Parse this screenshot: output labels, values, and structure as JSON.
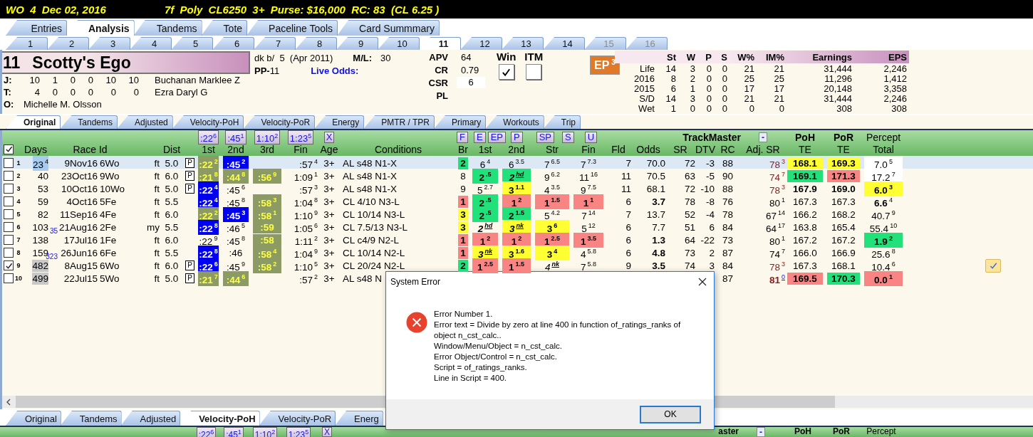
{
  "title_bar": {
    "race": "WO  4  Dec 02, 2016",
    "conditions": "7f  Poly  CL6250  3+  Purse: $16,000  RC: 83  (CL 6.25 )"
  },
  "main_tabs": [
    {
      "label": "Entries",
      "selected": false
    },
    {
      "label": "Analysis",
      "selected": true
    },
    {
      "label": "Tandems",
      "selected": false
    },
    {
      "label": "Tote",
      "selected": false
    },
    {
      "label": "Paceline Tools",
      "selected": false
    },
    {
      "label": "Card Summmary",
      "selected": false
    }
  ],
  "horse_tabs": [
    {
      "label": "1",
      "selected": false,
      "disabled": false
    },
    {
      "label": "2",
      "selected": false,
      "disabled": false
    },
    {
      "label": "3",
      "selected": false,
      "disabled": false
    },
    {
      "label": "4",
      "selected": false,
      "disabled": false
    },
    {
      "label": "5",
      "selected": false,
      "disabled": false
    },
    {
      "label": "6",
      "selected": false,
      "disabled": false
    },
    {
      "label": "7",
      "selected": false,
      "disabled": false
    },
    {
      "label": "8",
      "selected": false,
      "disabled": false
    },
    {
      "label": "9",
      "selected": false,
      "disabled": false
    },
    {
      "label": "10",
      "selected": false,
      "disabled": false
    },
    {
      "label": "11",
      "selected": true,
      "disabled": false
    },
    {
      "label": "12",
      "selected": false,
      "disabled": false
    },
    {
      "label": "13",
      "selected": false,
      "disabled": false
    },
    {
      "label": "14",
      "selected": false,
      "disabled": false
    },
    {
      "label": "15",
      "selected": false,
      "disabled": true
    },
    {
      "label": "16",
      "selected": false,
      "disabled": true
    }
  ],
  "horse": {
    "number": "11",
    "name": "Scotty's Ego",
    "description": "dk b/  5  (Apr 2011)",
    "ml_label": "M/L:",
    "ml": "30",
    "pp_label": "PP-",
    "pp": "11",
    "live_odds_label": "Live Odds:"
  },
  "connections": [
    {
      "label": "J:",
      "stats": [
        "10",
        "1",
        "0",
        "0",
        "10",
        "10"
      ],
      "name": "Buchanan Marklee Z"
    },
    {
      "label": "T:",
      "stats": [
        "4",
        "0",
        "0",
        "0",
        "0",
        "0"
      ],
      "name": "Ezra Daryl G"
    },
    {
      "label": "O:",
      "name": "Michelle M. Olsson"
    }
  ],
  "ratings": [
    {
      "label": "APV",
      "value": "64",
      "boxed": false
    },
    {
      "label": "CR",
      "value": "0.79",
      "boxed": false
    },
    {
      "label": "CSR",
      "value": "6",
      "boxed": true
    },
    {
      "label": "PL",
      "boxed": false
    }
  ],
  "bet_options": [
    {
      "label": "Win",
      "checked": true
    },
    {
      "label": "ITM",
      "checked": false
    }
  ],
  "ep_button": {
    "text": "EP",
    "sup": "3"
  },
  "stats": {
    "columns": [
      "St",
      "W",
      "P",
      "S",
      "W%",
      "IM%",
      "Earnings",
      "EPS"
    ],
    "rows": [
      {
        "label": "Life",
        "values": [
          "14",
          "3",
          "0",
          "0",
          "21",
          "21",
          "31,444",
          "2,246"
        ]
      },
      {
        "label": "2016",
        "values": [
          "8",
          "2",
          "0",
          "0",
          "25",
          "25",
          "11,296",
          "1,412"
        ]
      },
      {
        "label": "2015",
        "values": [
          "6",
          "1",
          "0",
          "0",
          "17",
          "17",
          "20,148",
          "3,358"
        ]
      },
      {
        "label": "S/D",
        "values": [
          "14",
          "3",
          "0",
          "0",
          "21",
          "21",
          "31,444",
          "2,246"
        ]
      },
      {
        "label": "Wet",
        "values": [
          "1",
          "0",
          "0",
          "0",
          "0",
          "0",
          "308",
          "308"
        ]
      }
    ]
  },
  "view_tabs": [
    {
      "label": "Original",
      "selected": true
    },
    {
      "label": "Tandems",
      "selected": false
    },
    {
      "label": "Adjusted",
      "selected": false
    },
    {
      "label": "Velocity-PoH",
      "selected": false
    },
    {
      "label": "Velocity-PoR",
      "selected": false
    },
    {
      "label": "Energy",
      "selected": false
    },
    {
      "label": "PMTR / TPR",
      "selected": false
    },
    {
      "label": "Primary",
      "selected": false
    },
    {
      "label": "Workouts",
      "selected": false
    },
    {
      "label": "Trip",
      "selected": false
    }
  ],
  "table": {
    "select_all": true,
    "fraction_buttons": [
      {
        "text": ":22",
        "sup": "6"
      },
      {
        "text": ":45",
        "sup": "1"
      },
      {
        "text": "1:10",
        "sup": "2"
      },
      {
        "text": "1:23",
        "sup": "5"
      },
      {
        "text": "X"
      }
    ],
    "pace_buttons": [
      "F",
      "E",
      "EP",
      "P",
      "SP",
      "S",
      "U"
    ],
    "trackmaster": "TrackMaster",
    "collapse_button": "-",
    "top_labels": [
      "PoH",
      "PoR",
      "Percept"
    ],
    "columns": [
      "Days",
      "Race Id",
      "Dist",
      "1st",
      "2nd",
      "3rd",
      "Fin",
      "Age",
      "Conditions",
      "Br",
      "1st",
      "2nd",
      "Str",
      "Fin",
      "Fld",
      "Odds",
      "SR",
      "DTV",
      "RC",
      "Adj. SR",
      "TE",
      "TE",
      "Total"
    ],
    "rows": [
      {
        "num": "1",
        "checked": false,
        "selected": true,
        "marked": false,
        "days": {
          "text": "23",
          "sup": "4",
          "color": "#a9cbef"
        },
        "date": "9Nov16",
        "track": "6Wo",
        "surface": "ft",
        "dist": "5.0",
        "post": "P",
        "c1": {
          "text": ":22",
          "sup": "2",
          "color": "#8c9a64",
          "bold": true
        },
        "c2": {
          "text": ":45",
          "sup": "2",
          "color": "#0000f0",
          "bold": true
        },
        "fin": {
          "text": ":57",
          "sup": "4"
        },
        "age": "3+",
        "conditions": "AL s48 N1-X",
        "br": {
          "text": "2",
          "color": "#22e07a",
          "bold": true
        },
        "p1": {
          "text": "6",
          "sup": "4"
        },
        "p2": {
          "text": "6",
          "sup": "3.5"
        },
        "str": {
          "text": "7",
          "sup": "6.5"
        },
        "pfin": {
          "text": "7",
          "sup": "7.3"
        },
        "fld": "7",
        "odds": "70.0",
        "sr": "72",
        "dtv": "-3",
        "rc": "88",
        "adj": {
          "text": "78",
          "sup": "3",
          "flagged": true
        },
        "poh": {
          "text": "168.1",
          "color": "#ffff33",
          "bold": true
        },
        "por": {
          "text": "169.3",
          "color": "#ffff33",
          "bold": true
        },
        "percept": {
          "text": "7.0",
          "sup": "5",
          "color": "#ffffff"
        }
      },
      {
        "num": "2",
        "checked": false,
        "selected": false,
        "marked": false,
        "days": "40",
        "date": "23Oct16",
        "track": "9Wo",
        "surface": "ft",
        "dist": "6.0",
        "post": "P",
        "c1": {
          "text": ":21",
          "sup": "8",
          "color": "#8c9a64",
          "bold": true
        },
        "c2": {
          "text": ":44",
          "sup": "8",
          "color": "#8c9a64",
          "bold": true
        },
        "c3": {
          "text": ":56",
          "sup": "9",
          "color": "#8c9a64",
          "bold": true
        },
        "fin": {
          "text": "1:09",
          "sup": "1"
        },
        "age": "3+",
        "conditions": "AL s48 N1-X",
        "br": "8",
        "p1": {
          "text": "2",
          "sup": ".5",
          "color": "#22e07a",
          "bold": true
        },
        "p2": {
          "text": "2",
          "sup": "hd",
          "color": "#22e07a",
          "bold": true,
          "italic": true
        },
        "str": {
          "text": "9",
          "sup": "6.2"
        },
        "pfin": {
          "text": "11",
          "sup": "16"
        },
        "fld": "11",
        "odds": "70.5",
        "sr": "63",
        "dtv": "-5",
        "rc": "90",
        "adj": {
          "text": "74",
          "sup": "7",
          "flagged": true
        },
        "poh": {
          "text": "169.1",
          "color": "#22e07a",
          "bold": true
        },
        "por": {
          "text": "171.3",
          "color": "#f88484",
          "bold": true
        },
        "percept": {
          "text": "17.2",
          "sup": "7",
          "color": "#ffffff"
        }
      },
      {
        "num": "3",
        "checked": false,
        "selected": false,
        "marked": false,
        "days": "53",
        "date": "10Oct16",
        "track": "10Wo",
        "surface": "ft",
        "dist": "5.0",
        "post": "P",
        "c1": {
          "text": ":22",
          "sup": "4",
          "color": "#0000f0",
          "bold": true
        },
        "c2": {
          "text": ":45",
          "sup": "6"
        },
        "fin": {
          "text": ":57",
          "sup": "3"
        },
        "age": "3+",
        "conditions": "AL s48 N1-X",
        "br": "9",
        "p1": {
          "text": "5",
          "sup": "2.7"
        },
        "p2": {
          "text": "3",
          "sup": "1.1",
          "color": "#ffff33",
          "bold": true
        },
        "str": {
          "text": "4",
          "sup": "3.5"
        },
        "pfin": {
          "text": "9",
          "sup": "7.5"
        },
        "fld": "11",
        "odds": "68.1",
        "sr": "72",
        "dtv": "-10",
        "rc": "88",
        "adj": {
          "text": "78",
          "sup": "3",
          "flagged": true
        },
        "poh": {
          "text": "167.9",
          "bold": true
        },
        "por": {
          "text": "169.0",
          "bold": true
        },
        "percept": {
          "text": "6.0",
          "sup": "3",
          "color": "#ffff33",
          "bold": true
        }
      },
      {
        "num": "4",
        "checked": false,
        "selected": false,
        "marked": false,
        "days": "59",
        "date": "4Oct16",
        "track": "5Fe",
        "surface": "ft",
        "dist": "5.5",
        "c1": {
          "text": ":22",
          "sup": "4",
          "color": "#0000f0",
          "bold": true
        },
        "c2": {
          "text": ":45",
          "sup": "8"
        },
        "c3": {
          "text": ":58",
          "sup": "3",
          "color": "#8c9a64",
          "bold": true
        },
        "fin": {
          "text": "1:04",
          "sup": "8"
        },
        "age": "3+",
        "conditions": "CL 4/10 N3-L",
        "br": {
          "text": "1",
          "color": "#f88484",
          "bold": true
        },
        "p1": {
          "text": "2",
          "sup": ".5",
          "color": "#22e07a",
          "bold": true
        },
        "p2": {
          "text": "1",
          "sup": "2",
          "color": "#f88484",
          "bold": true
        },
        "str": {
          "text": "1",
          "sup": "1.5",
          "color": "#f88484",
          "bold": true
        },
        "pfin": {
          "text": "1",
          "sup": "1",
          "color": "#f88484",
          "bold": true
        },
        "fld": "6",
        "odds": {
          "text": "3.7",
          "bold": true
        },
        "sr": "78",
        "dtv": "-8",
        "rc": "76",
        "adj": {
          "text": "80",
          "sup": "1"
        },
        "poh": "167.3",
        "por": "167.3",
        "percept": {
          "text": "6.6",
          "sup": "4",
          "bold": true
        }
      },
      {
        "num": "5",
        "checked": false,
        "selected": false,
        "marked": false,
        "days": "82",
        "date": "11Sep16",
        "track": "4Fe",
        "surface": "ft",
        "dist": "6.0",
        "c1": {
          "text": ":22",
          "sup": "2",
          "color": "#8c9a64",
          "bold": true
        },
        "c2": {
          "text": ":45",
          "sup": "3",
          "color": "#0000f0",
          "bold": true
        },
        "c3": {
          "text": ":58",
          "sup": "1",
          "color": "#8c9a64",
          "bold": true
        },
        "fin": {
          "text": "1:10",
          "sup": "9"
        },
        "age": "3+",
        "conditions": "CL 10/14 N3-L",
        "br": {
          "text": "3",
          "color": "#ffff33",
          "bold": true
        },
        "p1": {
          "text": "2",
          "sup": ".5",
          "color": "#22e07a",
          "bold": true
        },
        "p2": {
          "text": "2",
          "sup": "1.5",
          "color": "#22e07a",
          "bold": true
        },
        "str": {
          "text": "5",
          "sup": "4.2"
        },
        "pfin": {
          "text": "7",
          "sup": "14"
        },
        "fld": "7",
        "odds": "13.7",
        "sr": "52",
        "dtv": "-4",
        "rc": "78",
        "adj": {
          "text": "67",
          "sup": "14"
        },
        "poh": "166.2",
        "por": "168.2",
        "percept": {
          "text": "40.7",
          "sup": "9"
        }
      },
      {
        "num": "6",
        "checked": false,
        "selected": false,
        "marked": false,
        "days": "103",
        "layoff": "35",
        "date": "21Aug16",
        "track": "2Fe",
        "surface": "my",
        "dist": "5.5",
        "c1": {
          "text": ":22",
          "sup": "8",
          "color": "#0000f0",
          "bold": true
        },
        "c2": {
          "text": ":46",
          "sup": "5"
        },
        "c3": {
          "text": ":59",
          "color": "#8c9a64",
          "bold": true
        },
        "fin": {
          "text": "1:05",
          "sup": "6"
        },
        "age": "3+",
        "conditions": "CL 7.5/13 N3-L",
        "br": {
          "text": "3",
          "color": "#ffff33",
          "bold": true
        },
        "p1": {
          "text": "2",
          "sup": "hd",
          "bold": true,
          "italic": true
        },
        "p2": {
          "text": "3",
          "sup": "nk",
          "color": "#ffff33",
          "bold": true,
          "italic": true
        },
        "str": {
          "text": "3",
          "sup": "6",
          "color": "#ffff33",
          "bold": true
        },
        "pfin": {
          "text": "5",
          "sup": "12"
        },
        "fld": "6",
        "odds": "7.7",
        "sr": "51",
        "dtv": "6",
        "rc": "84",
        "adj": {
          "text": "64",
          "sup": "17"
        },
        "poh": "163.8",
        "por": "165.4",
        "percept": {
          "text": "55.4",
          "sup": "10"
        }
      },
      {
        "num": "7",
        "checked": false,
        "selected": false,
        "marked": false,
        "days": "138",
        "date": "17Jul16",
        "track": "1Fe",
        "surface": "ft",
        "dist": "6.0",
        "c1": {
          "text": ":22",
          "sup": "9"
        },
        "c2": {
          "text": ":45",
          "sup": "8"
        },
        "c3": {
          "text": ":58",
          "color": "#8c9a64",
          "bold": true
        },
        "fin": {
          "text": "1:11",
          "sup": "2"
        },
        "age": "3+",
        "conditions": "CL c4/9 N2-L",
        "br": {
          "text": "1",
          "color": "#f88484",
          "bold": true
        },
        "p1": {
          "text": "1",
          "sup": "2",
          "color": "#f88484",
          "bold": true
        },
        "p2": {
          "text": "1",
          "sup": "2",
          "color": "#f88484",
          "bold": true
        },
        "str": {
          "text": "1",
          "sup": "2.5",
          "color": "#f88484",
          "bold": true
        },
        "pfin": {
          "text": "1",
          "sup": "3.5",
          "color": "#f88484",
          "bold": true
        },
        "fld": "6",
        "odds": {
          "text": "1.3",
          "bold": true
        },
        "sr": "64",
        "dtv": "-22",
        "rc": "73",
        "adj": {
          "text": "80",
          "sup": "1"
        },
        "poh": "167.2",
        "por": "167.2",
        "percept": {
          "text": "1.9",
          "sup": "2",
          "color": "#22e07a",
          "bold": true
        }
      },
      {
        "num": "8",
        "checked": false,
        "selected": false,
        "marked": false,
        "days": "159",
        "layoff": "323",
        "date": "26Jun16",
        "track": "6Fe",
        "surface": "ft",
        "dist": "5.5",
        "c1": {
          "text": ":22",
          "sup": "8",
          "color": "#0000f0",
          "bold": true
        },
        "c2": {
          "text": ":46"
        },
        "c3": {
          "text": ":58",
          "sup": "4",
          "color": "#8c9a64",
          "bold": true
        },
        "fin": {
          "text": "1:04",
          "sup": "9"
        },
        "age": "3+",
        "conditions": "CL 10/14 N2-L",
        "br": {
          "text": "1",
          "color": "#f88484",
          "bold": true
        },
        "p1": {
          "text": "3",
          "sup": "nk",
          "color": "#ffff33",
          "bold": true,
          "italic": true
        },
        "p2": {
          "text": "3",
          "sup": "1.6",
          "color": "#ffff33",
          "bold": true
        },
        "str": {
          "text": "3",
          "sup": "4",
          "color": "#ffff33",
          "bold": true
        },
        "pfin": {
          "text": "4",
          "sup": "5.8"
        },
        "fld": "6",
        "odds": {
          "text": "4.8",
          "bold": true
        },
        "sr": "73",
        "dtv": "2",
        "rc": "87",
        "adj": {
          "text": "74",
          "sup": "7"
        },
        "poh": "166.0",
        "por": "166.9",
        "percept": {
          "text": "25.6",
          "sup": "8"
        }
      },
      {
        "num": "9",
        "checked": true,
        "selected": false,
        "marked": true,
        "days": {
          "text": "482",
          "color": "#c8c8c8"
        },
        "date": "8Aug15",
        "track": "6Wo",
        "surface": "ft",
        "dist": "6.0",
        "post": "P",
        "c1": {
          "text": ":22",
          "sup": "6",
          "color": "#0000f0",
          "bold": true
        },
        "c2": {
          "text": ":45",
          "sup": "9"
        },
        "c3": {
          "text": ":58",
          "sup": "2",
          "color": "#8c9a64",
          "bold": true
        },
        "fin": {
          "text": "1:10",
          "sup": "5"
        },
        "age": "3+",
        "conditions": "CL 20/24 N2-L",
        "br": {
          "text": "2",
          "color": "#22e07a",
          "bold": true
        },
        "p1": {
          "text": "1",
          "sup": "2.5",
          "color": "#f88484",
          "bold": true
        },
        "p2": {
          "text": "1",
          "sup": "1.5",
          "color": "#f88484",
          "bold": true
        },
        "str": {
          "text": "4",
          "sup": "nk",
          "italic": true
        },
        "pfin": {
          "text": "7",
          "sup": "5.8"
        },
        "fld": "9",
        "odds": {
          "text": "3.5",
          "bold": true
        },
        "sr": "74",
        "dtv": "3",
        "rc": "84",
        "adj": {
          "text": "78",
          "sup": "3",
          "flagged": true
        },
        "poh": "167.3",
        "por": "168.1",
        "percept": {
          "text": "10.4",
          "sup": "6"
        }
      },
      {
        "num": "10",
        "checked": false,
        "selected": false,
        "marked": false,
        "days": {
          "text": "499",
          "color": "#c8c8c8"
        },
        "date": "22Jul15",
        "track": "5Wo",
        "surface": "ft",
        "dist": "5.0",
        "post": "P",
        "c1": {
          "text": ":21",
          "sup": "7",
          "color": "#8c9a64",
          "bold": true
        },
        "c2": {
          "text": ":44",
          "sup": "6",
          "color": "#8c9a64",
          "bold": true
        },
        "fin": {
          "text": ":57",
          "sup": "2"
        },
        "age": "3+",
        "conditions": "AL s48 N",
        "rc": "87",
        "adj": {
          "text": "81",
          "sup": "0",
          "flagged": true,
          "bold": true,
          "link": true
        },
        "poh": {
          "text": "169.5",
          "color": "#f88484",
          "bold": true
        },
        "por": {
          "text": "170.3",
          "color": "#22e07a",
          "bold": true
        },
        "percept": {
          "text": "0.0",
          "sup": "1",
          "color": "#f88484",
          "bold": true
        }
      }
    ]
  },
  "bottom_tabs": [
    {
      "label": "Original",
      "selected": false
    },
    {
      "label": "Tandems",
      "selected": false
    },
    {
      "label": "Adjusted",
      "selected": false
    },
    {
      "label": "Velocity-PoH",
      "selected": true
    },
    {
      "label": "Velocity-PoR",
      "selected": false
    },
    {
      "label": "Energ",
      "selected": false
    }
  ],
  "bottom_header": {
    "fraction_buttons": [
      {
        "text": ":22",
        "sup": "6"
      },
      {
        "text": ":45",
        "sup": "1"
      },
      {
        "text": "1:10",
        "sup": "2"
      },
      {
        "text": "1:23",
        "sup": "5"
      },
      {
        "text": "X"
      }
    ],
    "trackmaster": "aster",
    "collapse_button": "-",
    "top_labels": [
      "PoH",
      "PoR",
      "Percept"
    ]
  },
  "dialog": {
    "title": "System Error",
    "lines": [
      "Error Number 1.",
      "Error text = Divide by zero at line 400 in function of_ratings_ranks of object n_cst_calc..",
      "Window/Menu/Object = n_cst_calc.",
      "Error Object/Control = n_cst_calc.",
      "Script = of_ratings_ranks.",
      "Line in Script = 400."
    ],
    "button": "OK"
  }
}
